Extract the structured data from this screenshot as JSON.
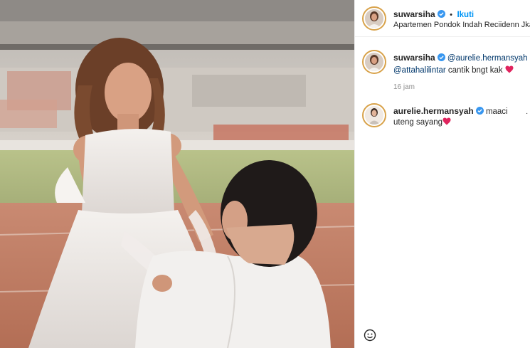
{
  "post": {
    "author": "suwarsiha",
    "follow_label": "Ikuti",
    "separator": "•",
    "location": "Apartemen Pondok Indah Reciidenn Jkarta S"
  },
  "caption": {
    "author": "suwarsiha",
    "mention_1": "@aurelie.hermansyah",
    "mention_2": "@attahalilintar",
    "text": "cantik bngt kak",
    "time": "16 jam"
  },
  "comments": [
    {
      "author": "aurelie.hermansyah",
      "text_line1": "maaci",
      "text_line2": "uteng sayang"
    }
  ],
  "icons": {
    "verified": "verified-badge-icon",
    "heart": "red-heart-emoji",
    "more": "more-options-icon"
  },
  "colors": {
    "verified_blue": "#3897f0",
    "link_blue": "#0095f6",
    "mention_blue": "#00376b",
    "heart_red": "#e0245e",
    "muted": "#8e8e8e"
  }
}
